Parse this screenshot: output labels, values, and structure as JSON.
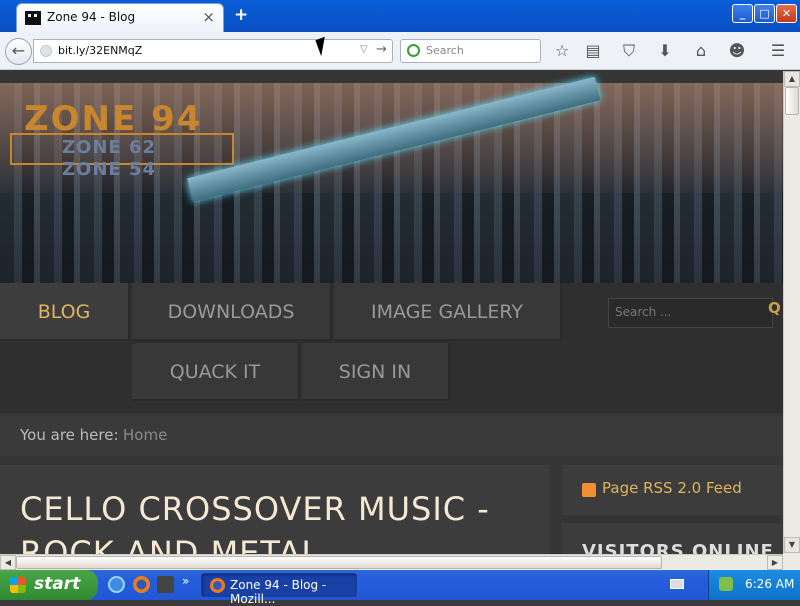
{
  "browser": {
    "tab_title": "Zone 94 - Blog",
    "tab_close": "×",
    "new_tab": "+",
    "window_buttons": {
      "minimize": "_",
      "maximize": "□",
      "close": "✕"
    },
    "url": "bit.ly/32ENMqZ",
    "search_placeholder": "Search",
    "back_glyph": "←",
    "go_glyph": "→",
    "dropdown_glyph": "▽",
    "toolbar_icons": {
      "bookmark": "☆",
      "reading_list": "▤",
      "pocket": "⛉",
      "download": "⬇",
      "home": "⌂",
      "hello": "☻",
      "menu": "☰"
    }
  },
  "site": {
    "logo": {
      "main": "ZONE 94",
      "sub1": "ZONE 62",
      "sub2": "ZONE 54"
    },
    "menu": {
      "blog": "BLOG",
      "downloads": "DOWNLOADS",
      "image_gallery": "IMAGE GALLERY",
      "quack_it": "QUACK IT",
      "sign_in": "SIGN IN"
    },
    "search_placeholder": "Search ...",
    "search_icon": "Q",
    "breadcrumb": {
      "label": "You are here:",
      "home": "Home"
    },
    "article_title": "CELLO CROSSOVER MUSIC - ROCK AND METAL",
    "sidebar": {
      "rss": "Page RSS 2.0 Feed",
      "visitors": "VISITORS ONLINE"
    }
  },
  "scrollbars": {
    "up": "▲",
    "down": "▼",
    "left": "◀",
    "right": "▶"
  },
  "taskbar": {
    "start": "start",
    "more": "»",
    "task_label": "Zone 94 - Blog - Mozill...",
    "clock": "6:26 AM"
  },
  "colors": {
    "accent": "#e0b45e",
    "logo": "#c8862f",
    "taskbar": "#245edb"
  }
}
